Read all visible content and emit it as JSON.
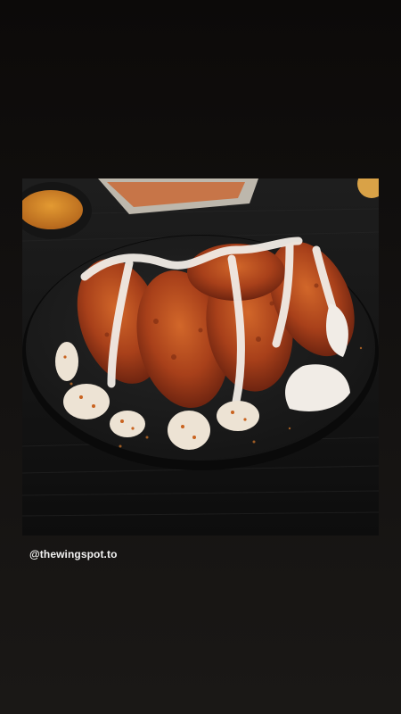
{
  "story": {
    "credit_handle": "@thewingspot.to",
    "photo": {
      "subject": "plate-of-spicy-chicken-wings-with-ranch",
      "colors": {
        "table": "#121212",
        "plate": "#1c1c1c",
        "wing_sauce": "#b5461a",
        "ranch": "#f1ece6",
        "seasoning": "#e08a2a"
      }
    }
  }
}
